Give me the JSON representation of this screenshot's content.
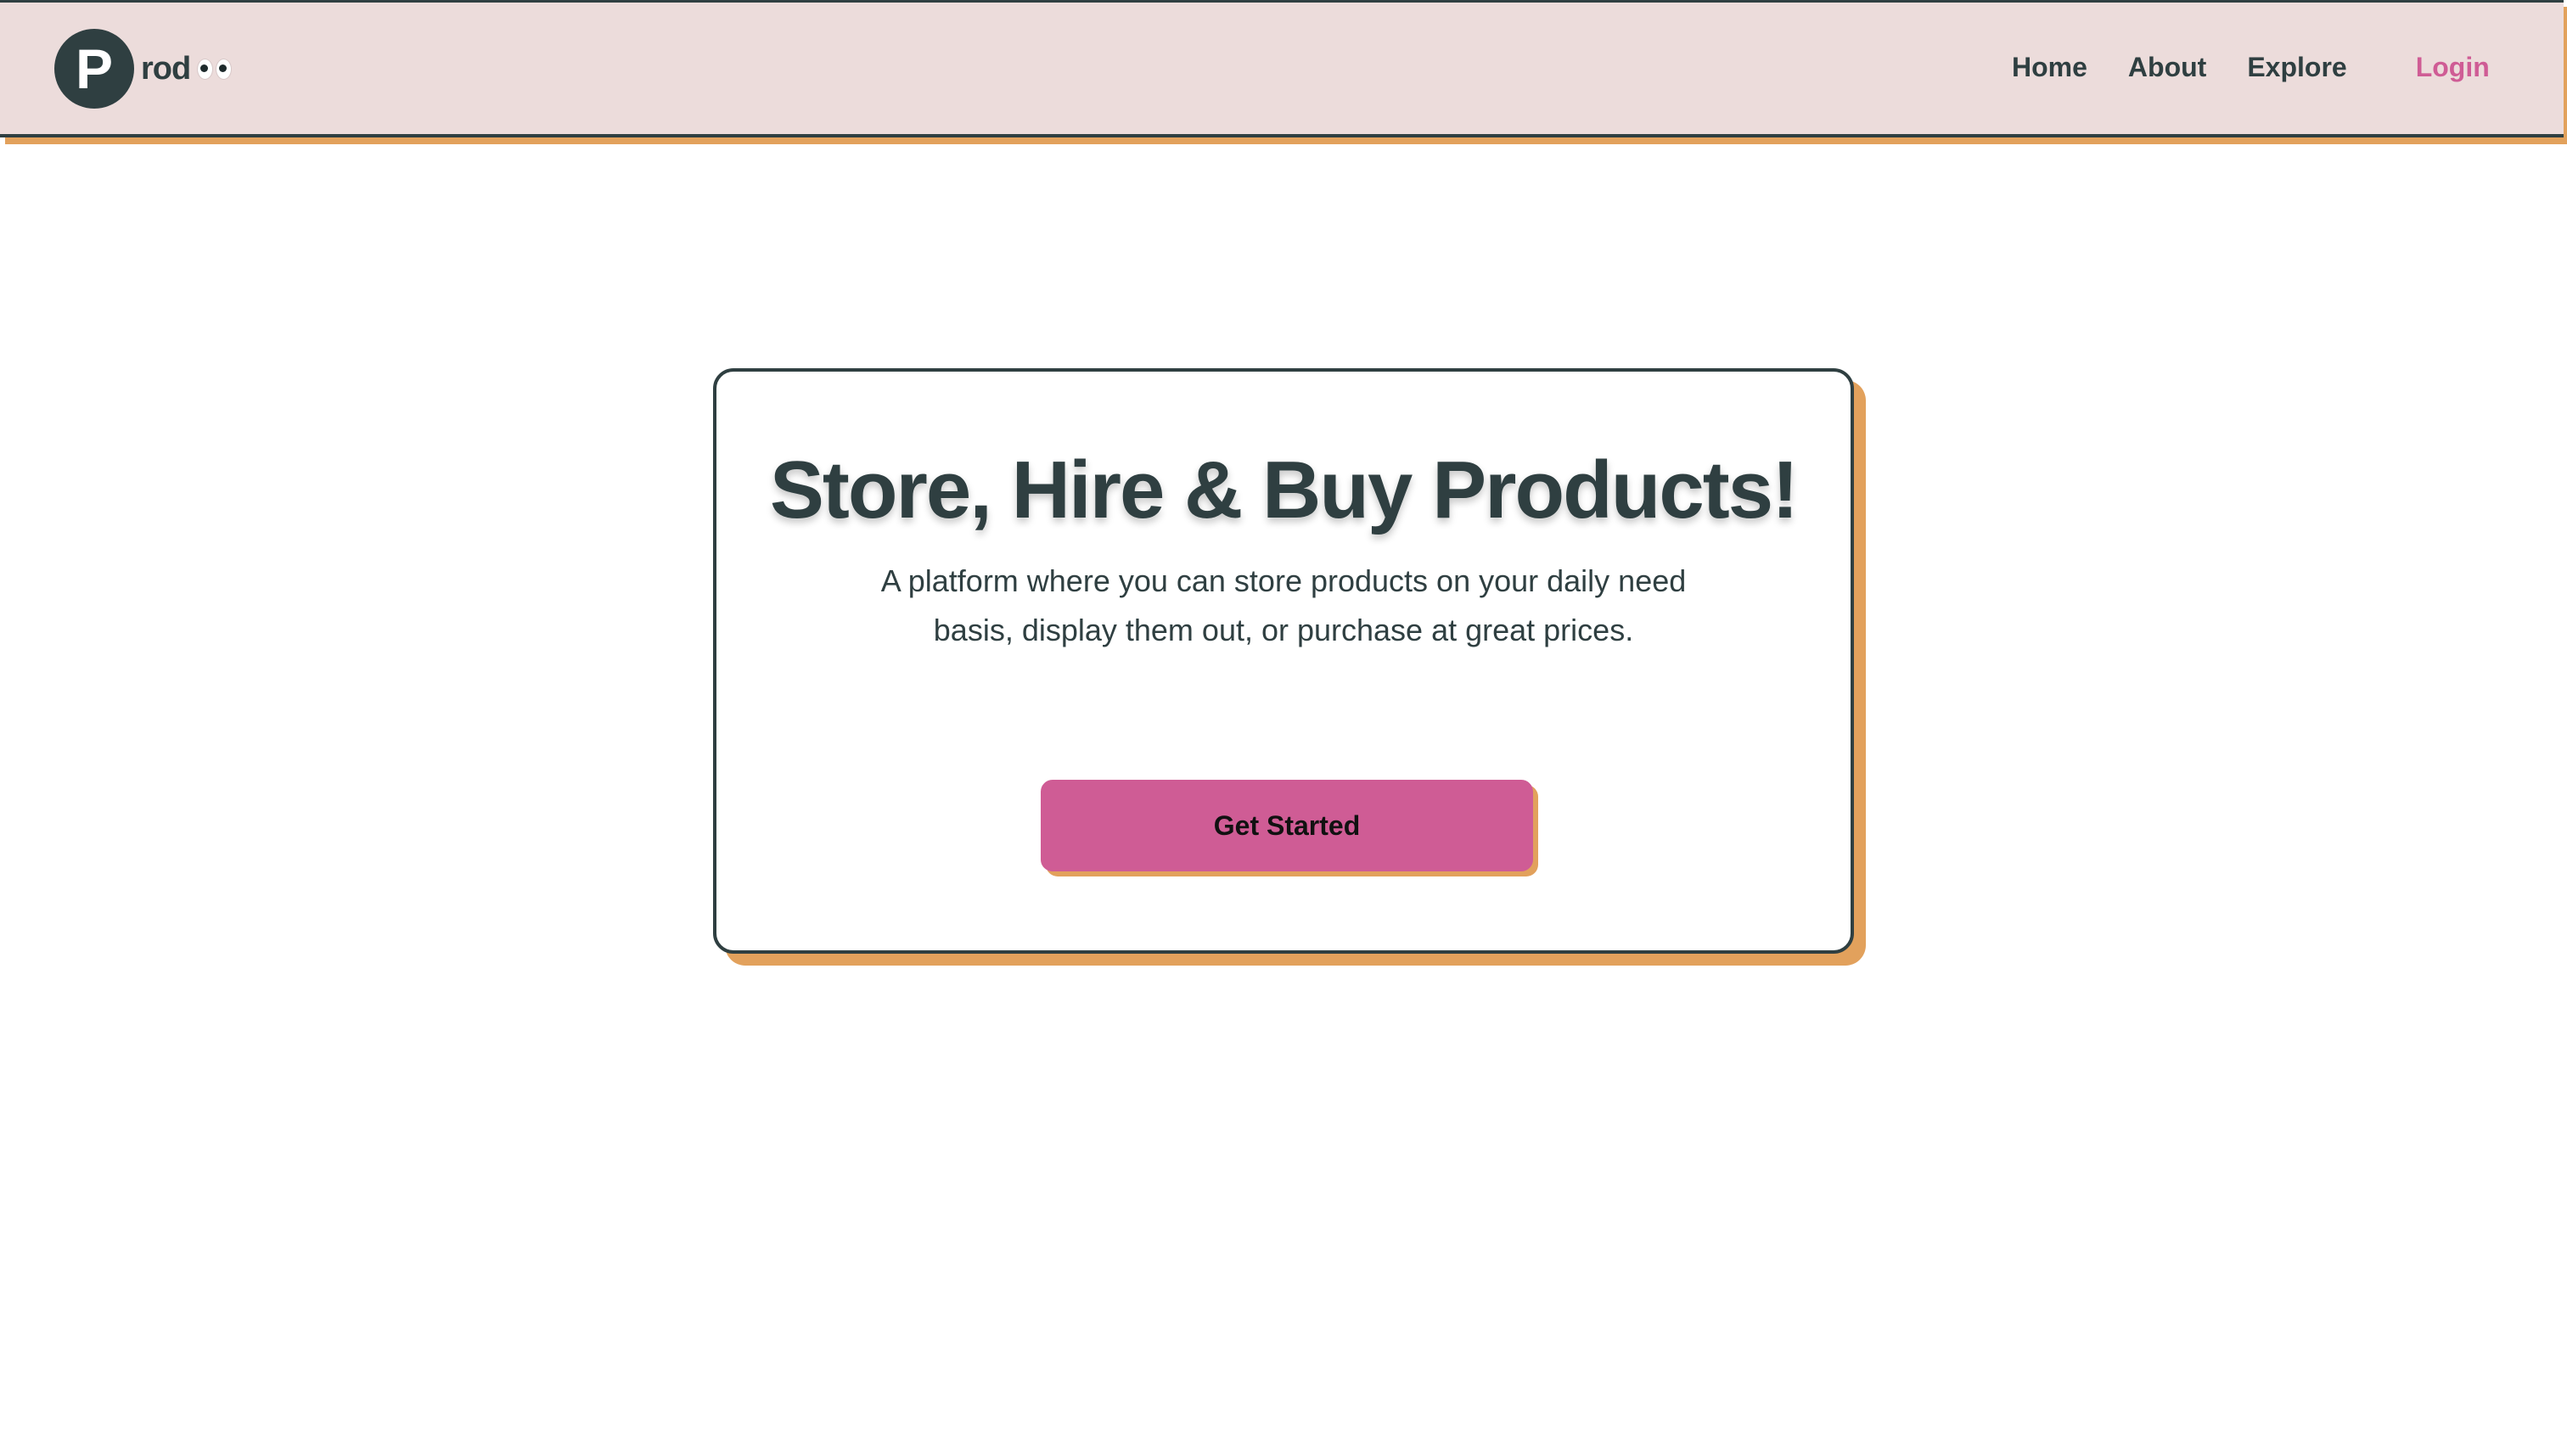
{
  "brand": {
    "badge_letter": "P",
    "name_rest": "rod"
  },
  "nav": {
    "items": [
      "Home",
      "About",
      "Explore"
    ],
    "login_label": "Login"
  },
  "hero": {
    "title": "Store, Hire & Buy Products!",
    "description": "A platform where you can store products on your daily need basis, display them out, or purchase at great prices.",
    "cta_label": "Get Started"
  },
  "colors": {
    "dark": "#2f3f41",
    "navbar_bg": "#ecdcdb",
    "accent_pink": "#cf5c95",
    "shadow_orange": "#e2a15c"
  },
  "icons": {
    "logo": "letter-p-badge",
    "eyes": "eyes-emoji"
  }
}
